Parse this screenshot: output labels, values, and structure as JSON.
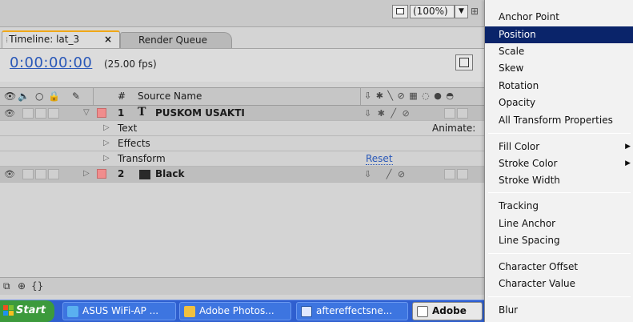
{
  "toolbar": {
    "zoom": "(100%)",
    "zoom_arrow": "▼"
  },
  "tabs": [
    {
      "label": "Timeline: lat_3",
      "close": "×"
    },
    {
      "label": "Render Queue"
    }
  ],
  "timeline": {
    "timecode": "0:00:00:00",
    "fps": "(25.00 fps)",
    "header": {
      "hash": "#",
      "source_name": "Source Name"
    },
    "layers": [
      {
        "number": "1",
        "type_glyph": "T",
        "name": "PUSKOM USAKTI"
      },
      {
        "number": "2",
        "name": "Black"
      }
    ],
    "sub_props": {
      "text": "Text",
      "animate": "Animate:",
      "effects": "Effects",
      "transform": "Transform",
      "reset": "Reset"
    }
  },
  "taskbar": {
    "start": "Start",
    "items": [
      {
        "label": "ASUS WiFi-AP ..."
      },
      {
        "label": "Adobe Photos..."
      },
      {
        "label": "aftereffectsne..."
      },
      {
        "label": "Adobe"
      }
    ]
  },
  "menu": {
    "items": [
      "Anchor Point",
      "Position",
      "Scale",
      "Skew",
      "Rotation",
      "Opacity",
      "All Transform Properties",
      "Fill Color",
      "Stroke Color",
      "Stroke Width",
      "Tracking",
      "Line Anchor",
      "Line Spacing",
      "Character Offset",
      "Character Value",
      "Blur"
    ],
    "highlighted": "Position"
  },
  "colors": {
    "timecode": "#2a58b8",
    "tab_accent": "#f0a818",
    "menu_highlight": "#0a246a",
    "label_red": "#f08d8d",
    "taskbar_blue": "#2f5fcf",
    "start_green": "#3c9a3c"
  }
}
